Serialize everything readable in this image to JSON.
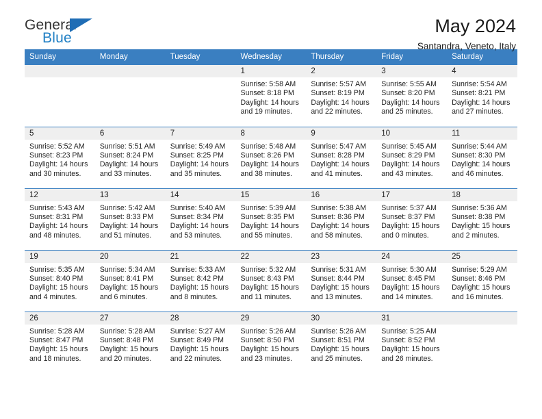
{
  "logo": {
    "word1": "General",
    "word2": "Blue",
    "triangle_color": "#1f6db5",
    "blue_text_color": "#1f7fc4"
  },
  "header": {
    "title": "May 2024",
    "subtitle": "Santandra, Veneto, Italy"
  },
  "theme": {
    "header_bg": "#3a7fc1",
    "daynum_bg": "#efefef",
    "grid_line": "#3a7fc1"
  },
  "weekday_headers": [
    "Sunday",
    "Monday",
    "Tuesday",
    "Wednesday",
    "Thursday",
    "Friday",
    "Saturday"
  ],
  "labels": {
    "sunrise": "Sunrise:",
    "sunset": "Sunset:",
    "daylight": "Daylight:"
  },
  "weeks": [
    [
      {
        "day": "",
        "sunrise": "",
        "sunset": "",
        "daylight": ""
      },
      {
        "day": "",
        "sunrise": "",
        "sunset": "",
        "daylight": ""
      },
      {
        "day": "",
        "sunrise": "",
        "sunset": "",
        "daylight": ""
      },
      {
        "day": "1",
        "sunrise": "Sunrise: 5:58 AM",
        "sunset": "Sunset: 8:18 PM",
        "daylight": "Daylight: 14 hours and 19 minutes."
      },
      {
        "day": "2",
        "sunrise": "Sunrise: 5:57 AM",
        "sunset": "Sunset: 8:19 PM",
        "daylight": "Daylight: 14 hours and 22 minutes."
      },
      {
        "day": "3",
        "sunrise": "Sunrise: 5:55 AM",
        "sunset": "Sunset: 8:20 PM",
        "daylight": "Daylight: 14 hours and 25 minutes."
      },
      {
        "day": "4",
        "sunrise": "Sunrise: 5:54 AM",
        "sunset": "Sunset: 8:21 PM",
        "daylight": "Daylight: 14 hours and 27 minutes."
      }
    ],
    [
      {
        "day": "5",
        "sunrise": "Sunrise: 5:52 AM",
        "sunset": "Sunset: 8:23 PM",
        "daylight": "Daylight: 14 hours and 30 minutes."
      },
      {
        "day": "6",
        "sunrise": "Sunrise: 5:51 AM",
        "sunset": "Sunset: 8:24 PM",
        "daylight": "Daylight: 14 hours and 33 minutes."
      },
      {
        "day": "7",
        "sunrise": "Sunrise: 5:49 AM",
        "sunset": "Sunset: 8:25 PM",
        "daylight": "Daylight: 14 hours and 35 minutes."
      },
      {
        "day": "8",
        "sunrise": "Sunrise: 5:48 AM",
        "sunset": "Sunset: 8:26 PM",
        "daylight": "Daylight: 14 hours and 38 minutes."
      },
      {
        "day": "9",
        "sunrise": "Sunrise: 5:47 AM",
        "sunset": "Sunset: 8:28 PM",
        "daylight": "Daylight: 14 hours and 41 minutes."
      },
      {
        "day": "10",
        "sunrise": "Sunrise: 5:45 AM",
        "sunset": "Sunset: 8:29 PM",
        "daylight": "Daylight: 14 hours and 43 minutes."
      },
      {
        "day": "11",
        "sunrise": "Sunrise: 5:44 AM",
        "sunset": "Sunset: 8:30 PM",
        "daylight": "Daylight: 14 hours and 46 minutes."
      }
    ],
    [
      {
        "day": "12",
        "sunrise": "Sunrise: 5:43 AM",
        "sunset": "Sunset: 8:31 PM",
        "daylight": "Daylight: 14 hours and 48 minutes."
      },
      {
        "day": "13",
        "sunrise": "Sunrise: 5:42 AM",
        "sunset": "Sunset: 8:33 PM",
        "daylight": "Daylight: 14 hours and 51 minutes."
      },
      {
        "day": "14",
        "sunrise": "Sunrise: 5:40 AM",
        "sunset": "Sunset: 8:34 PM",
        "daylight": "Daylight: 14 hours and 53 minutes."
      },
      {
        "day": "15",
        "sunrise": "Sunrise: 5:39 AM",
        "sunset": "Sunset: 8:35 PM",
        "daylight": "Daylight: 14 hours and 55 minutes."
      },
      {
        "day": "16",
        "sunrise": "Sunrise: 5:38 AM",
        "sunset": "Sunset: 8:36 PM",
        "daylight": "Daylight: 14 hours and 58 minutes."
      },
      {
        "day": "17",
        "sunrise": "Sunrise: 5:37 AM",
        "sunset": "Sunset: 8:37 PM",
        "daylight": "Daylight: 15 hours and 0 minutes."
      },
      {
        "day": "18",
        "sunrise": "Sunrise: 5:36 AM",
        "sunset": "Sunset: 8:38 PM",
        "daylight": "Daylight: 15 hours and 2 minutes."
      }
    ],
    [
      {
        "day": "19",
        "sunrise": "Sunrise: 5:35 AM",
        "sunset": "Sunset: 8:40 PM",
        "daylight": "Daylight: 15 hours and 4 minutes."
      },
      {
        "day": "20",
        "sunrise": "Sunrise: 5:34 AM",
        "sunset": "Sunset: 8:41 PM",
        "daylight": "Daylight: 15 hours and 6 minutes."
      },
      {
        "day": "21",
        "sunrise": "Sunrise: 5:33 AM",
        "sunset": "Sunset: 8:42 PM",
        "daylight": "Daylight: 15 hours and 8 minutes."
      },
      {
        "day": "22",
        "sunrise": "Sunrise: 5:32 AM",
        "sunset": "Sunset: 8:43 PM",
        "daylight": "Daylight: 15 hours and 11 minutes."
      },
      {
        "day": "23",
        "sunrise": "Sunrise: 5:31 AM",
        "sunset": "Sunset: 8:44 PM",
        "daylight": "Daylight: 15 hours and 13 minutes."
      },
      {
        "day": "24",
        "sunrise": "Sunrise: 5:30 AM",
        "sunset": "Sunset: 8:45 PM",
        "daylight": "Daylight: 15 hours and 14 minutes."
      },
      {
        "day": "25",
        "sunrise": "Sunrise: 5:29 AM",
        "sunset": "Sunset: 8:46 PM",
        "daylight": "Daylight: 15 hours and 16 minutes."
      }
    ],
    [
      {
        "day": "26",
        "sunrise": "Sunrise: 5:28 AM",
        "sunset": "Sunset: 8:47 PM",
        "daylight": "Daylight: 15 hours and 18 minutes."
      },
      {
        "day": "27",
        "sunrise": "Sunrise: 5:28 AM",
        "sunset": "Sunset: 8:48 PM",
        "daylight": "Daylight: 15 hours and 20 minutes."
      },
      {
        "day": "28",
        "sunrise": "Sunrise: 5:27 AM",
        "sunset": "Sunset: 8:49 PM",
        "daylight": "Daylight: 15 hours and 22 minutes."
      },
      {
        "day": "29",
        "sunrise": "Sunrise: 5:26 AM",
        "sunset": "Sunset: 8:50 PM",
        "daylight": "Daylight: 15 hours and 23 minutes."
      },
      {
        "day": "30",
        "sunrise": "Sunrise: 5:26 AM",
        "sunset": "Sunset: 8:51 PM",
        "daylight": "Daylight: 15 hours and 25 minutes."
      },
      {
        "day": "31",
        "sunrise": "Sunrise: 5:25 AM",
        "sunset": "Sunset: 8:52 PM",
        "daylight": "Daylight: 15 hours and 26 minutes."
      },
      {
        "day": "",
        "sunrise": "",
        "sunset": "",
        "daylight": ""
      }
    ]
  ]
}
